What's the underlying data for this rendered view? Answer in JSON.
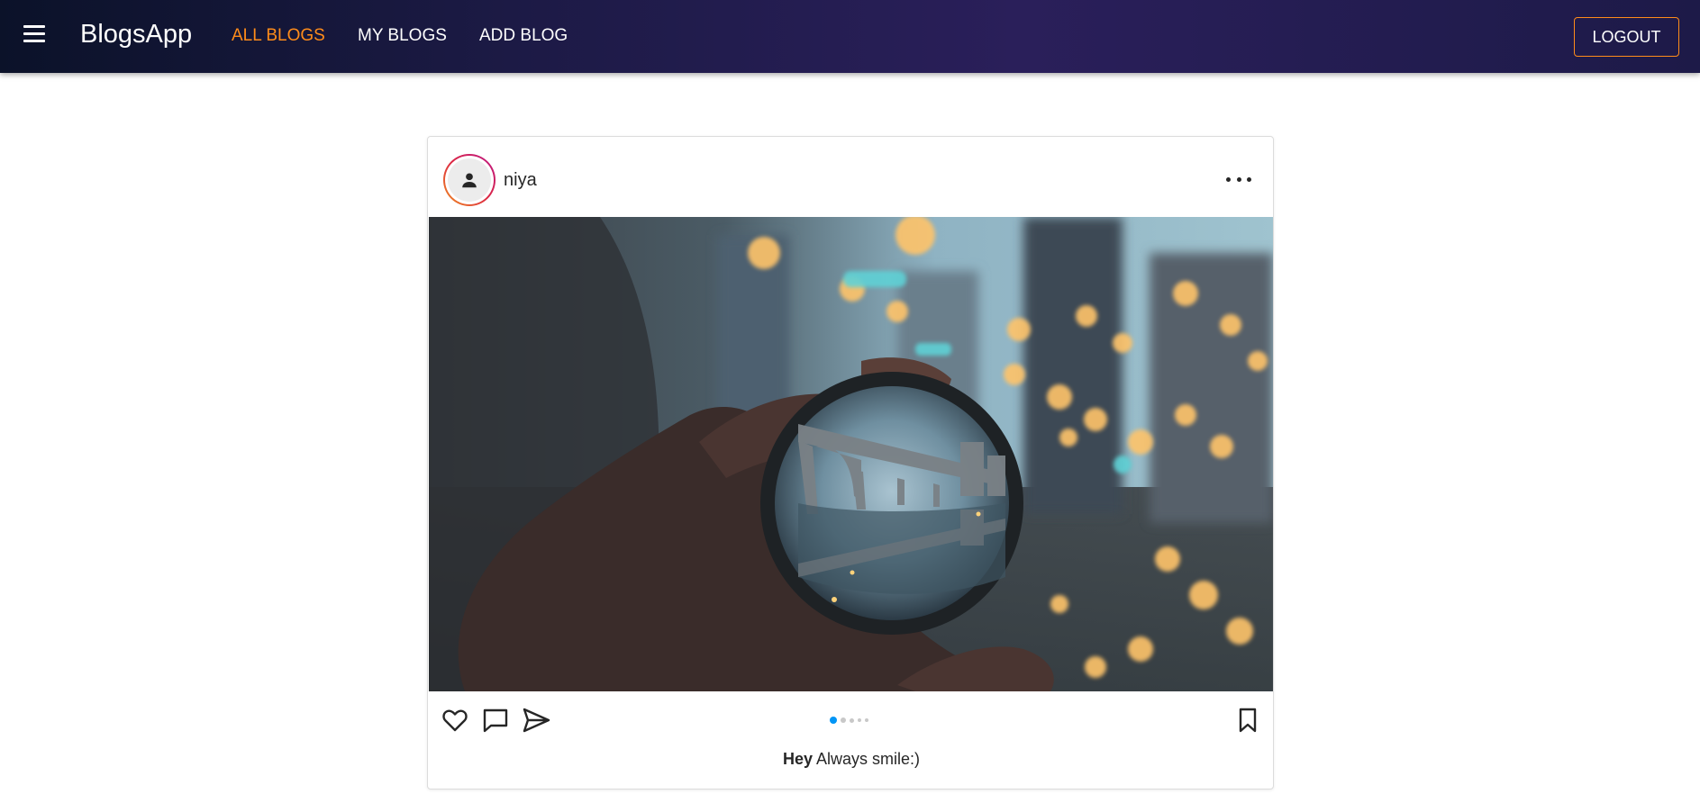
{
  "app": {
    "brand": "BlogsApp",
    "nav": [
      {
        "label": "ALL BLOGS",
        "active": true
      },
      {
        "label": "MY BLOGS",
        "active": false
      },
      {
        "label": "ADD BLOG",
        "active": false
      }
    ],
    "logout_label": "LOGOUT",
    "accent_color": "#ff8c1a",
    "menu_icon": "hamburger-menu-icon"
  },
  "post": {
    "username": "niya",
    "avatar_icon": "person-icon",
    "more_icon": "more-horizontal-icon",
    "image_alt": "Hand holding a lens ball reflecting a bridge against city bokeh lights",
    "actions": [
      "heart-icon",
      "comment-icon",
      "send-icon",
      "bookmark-icon"
    ],
    "carousel_count": 5,
    "carousel_active_index": 0,
    "caption_title": "Hey",
    "caption_text": "Always smile:)"
  }
}
